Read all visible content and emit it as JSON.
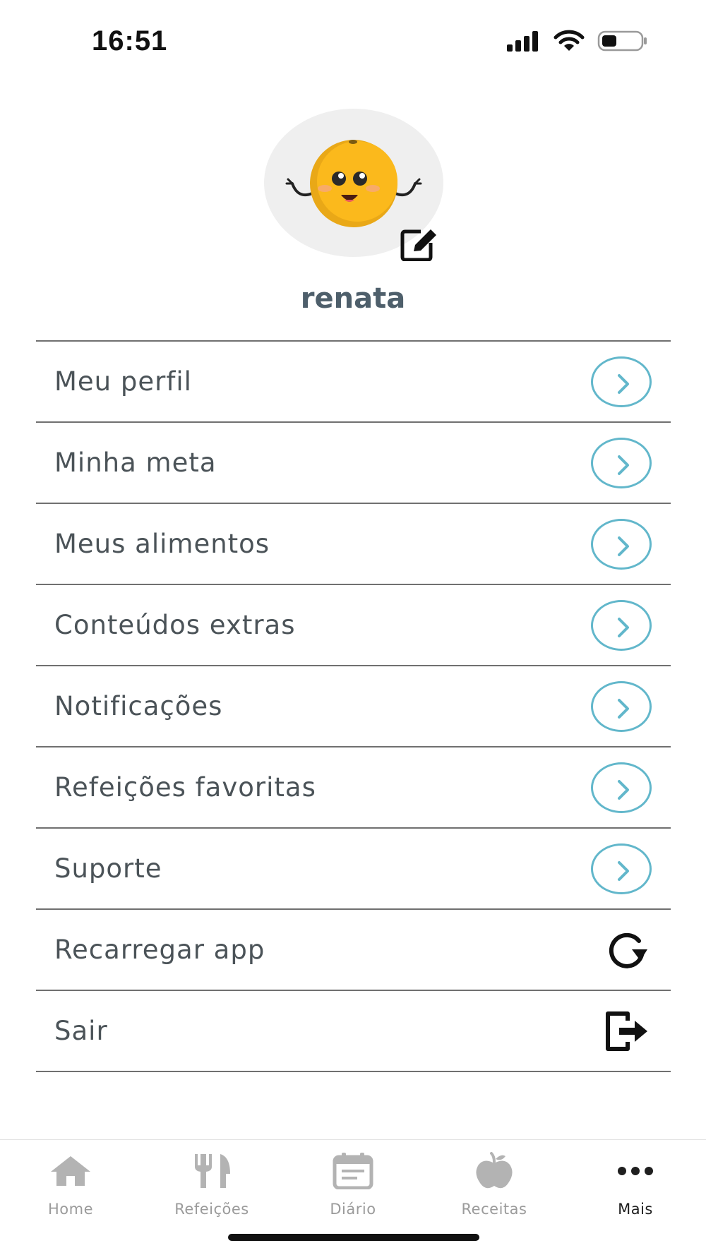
{
  "status_bar": {
    "time": "16:51"
  },
  "profile": {
    "username": "renata"
  },
  "menu": {
    "items": [
      {
        "label": "Meu perfil",
        "icon": "chevron-right-circle-icon"
      },
      {
        "label": "Minha meta",
        "icon": "chevron-right-circle-icon"
      },
      {
        "label": "Meus alimentos",
        "icon": "chevron-right-circle-icon"
      },
      {
        "label": "Conteúdos extras",
        "icon": "chevron-right-circle-icon"
      },
      {
        "label": "Notificações",
        "icon": "chevron-right-circle-icon"
      },
      {
        "label": "Refeições favoritas",
        "icon": "chevron-right-circle-icon"
      },
      {
        "label": "Suporte",
        "icon": "chevron-right-circle-icon"
      },
      {
        "label": "Recarregar app",
        "icon": "reload-icon"
      },
      {
        "label": "Sair",
        "icon": "logout-icon"
      }
    ]
  },
  "bottom_nav": {
    "items": [
      {
        "label": "Home",
        "icon": "home-icon",
        "active": false
      },
      {
        "label": "Refeições",
        "icon": "fork-knife-icon",
        "active": false
      },
      {
        "label": "Diário",
        "icon": "calendar-icon",
        "active": false
      },
      {
        "label": "Receitas",
        "icon": "apple-icon",
        "active": false
      },
      {
        "label": "Mais",
        "icon": "more-dots-icon",
        "active": true
      }
    ]
  },
  "colors": {
    "accent": "#62b7cb",
    "text": "#4b5358",
    "username": "#4e5f6b",
    "nav_inactive": "#9b9b9b",
    "nav_active": "#1f1f1f",
    "divider": "#707070"
  }
}
